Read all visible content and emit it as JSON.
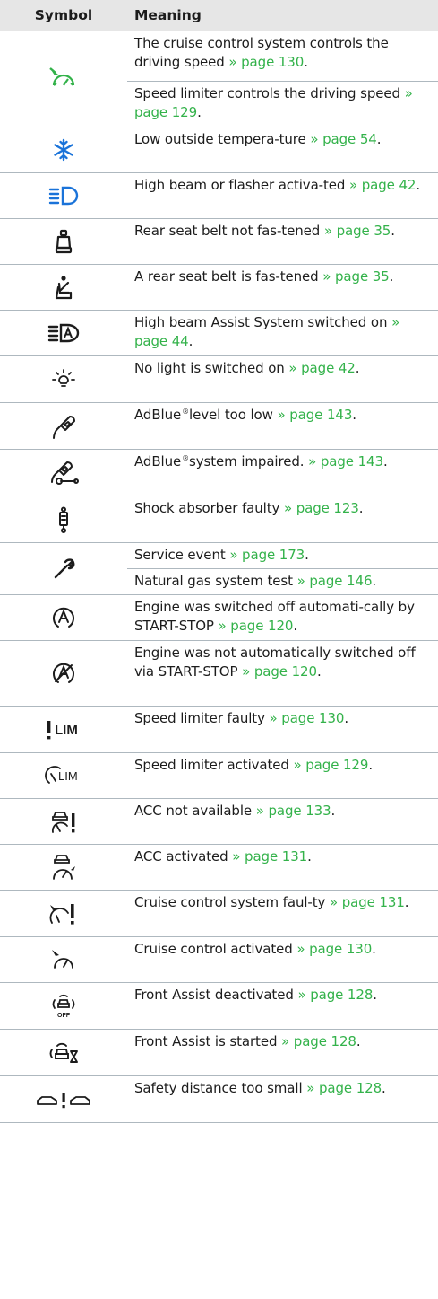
{
  "header": {
    "symbol": "Symbol",
    "meaning": "Meaning"
  },
  "colors": {
    "green": "#33b24a",
    "blue": "#1a73d9",
    "text": "#1c1c1c",
    "header_bg": "#e6e6e6"
  },
  "rows": [
    {
      "icon": "cruise-control-icon",
      "text": "The cruise control system controls the driving speed",
      "link": "» page 130",
      "tail": "."
    },
    {
      "text": "Speed limiter controls the driving speed",
      "link": "» page 129",
      "tail": "."
    },
    {
      "icon": "snowflake-icon",
      "text": "Low outside tempera-ture",
      "link": "» page 54",
      "tail": "."
    },
    {
      "icon": "high-beam-icon",
      "text": "High beam or flasher activa-ted",
      "link": "» page 42",
      "tail": "."
    },
    {
      "icon": "rear-seatbelt-icon",
      "text": "Rear seat belt not fas-tened",
      "link": "» page 35",
      "tail": "."
    },
    {
      "icon": "seatbelt-fastened-icon",
      "text": "A rear seat belt is fas-tened",
      "link": "» page 35",
      "tail": "."
    },
    {
      "icon": "high-beam-assist-icon",
      "text": "High beam Assist System switched on",
      "link": "» page 44",
      "tail": "."
    },
    {
      "icon": "light-off-icon",
      "text": "No light is switched on",
      "link": "» page 42",
      "tail": "."
    },
    {
      "icon": "adblue-level-icon",
      "text_pre": "AdBlue",
      "sup": "®",
      "text": "level too low",
      "link": "» page 143",
      "tail": "."
    },
    {
      "icon": "adblue-system-icon",
      "text_pre": "AdBlue",
      "sup": "®",
      "text": "system impaired.",
      "link": "» page 143",
      "tail": "."
    },
    {
      "icon": "shock-absorber-icon",
      "text": "Shock absorber faulty",
      "link": "» page 123",
      "tail": "."
    },
    {
      "icon": "wrench-icon",
      "text": "Service event",
      "link": "» page 173",
      "tail": "."
    },
    {
      "text": "Natural gas system test",
      "link": "» page 146",
      "tail": "."
    },
    {
      "icon": "start-stop-icon",
      "text": "Engine was switched off automati-cally by START-STOP",
      "link": "» page 120",
      "tail": "."
    },
    {
      "icon": "start-stop-off-icon",
      "text": "Engine was not automatically switched off via START-STOP",
      "link": "» page 120",
      "tail": "."
    },
    {
      "icon": "limiter-fault-icon",
      "icon_text": "LIM",
      "text": "Speed limiter faulty",
      "link": "» page 130",
      "tail": "."
    },
    {
      "icon": "limiter-active-icon",
      "icon_text": "LIM",
      "text": "Speed limiter activated",
      "link": "» page 129",
      "tail": "."
    },
    {
      "icon": "acc-unavailable-icon",
      "text": "ACC not available",
      "link": "» page 133",
      "tail": "."
    },
    {
      "icon": "acc-active-icon",
      "text": "ACC activated",
      "link": "» page 131",
      "tail": "."
    },
    {
      "icon": "cruise-fault-icon",
      "text": "Cruise control system faul-ty",
      "link": "» page 131",
      "tail": "."
    },
    {
      "icon": "cruise-active-icon",
      "text": "Cruise control activated",
      "link": "» page 130",
      "tail": "."
    },
    {
      "icon": "front-assist-off-icon",
      "icon_text": "OFF",
      "text": "Front Assist deactivated",
      "link": "» page 128",
      "tail": "."
    },
    {
      "icon": "front-assist-started-icon",
      "text": "Front Assist is started",
      "link": "» page 128",
      "tail": "."
    },
    {
      "icon": "safety-distance-icon",
      "text": "Safety distance too small",
      "link": "» page 128",
      "tail": "."
    }
  ]
}
